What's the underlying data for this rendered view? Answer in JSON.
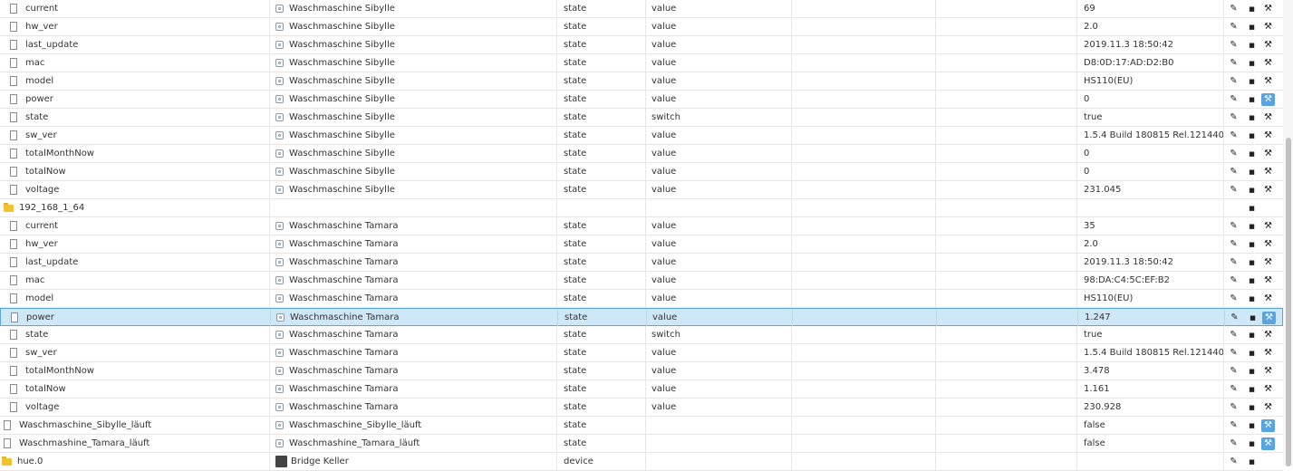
{
  "table": {
    "rows": [
      {
        "kind": "state",
        "indent": 1,
        "id": "current",
        "name": "Waschmaschine Sibylle",
        "role": "state",
        "type": "value",
        "value": "69",
        "wrench_active": false
      },
      {
        "kind": "state",
        "indent": 1,
        "id": "hw_ver",
        "name": "Waschmaschine Sibylle",
        "role": "state",
        "type": "value",
        "value": "2.0",
        "wrench_active": false
      },
      {
        "kind": "state",
        "indent": 1,
        "id": "last_update",
        "name": "Waschmaschine Sibylle",
        "role": "state",
        "type": "value",
        "value": "2019.11.3 18:50:42",
        "wrench_active": false
      },
      {
        "kind": "state",
        "indent": 1,
        "id": "mac",
        "name": "Waschmaschine Sibylle",
        "role": "state",
        "type": "value",
        "value": "D8:0D:17:AD:D2:B0",
        "wrench_active": false
      },
      {
        "kind": "state",
        "indent": 1,
        "id": "model",
        "name": "Waschmaschine Sibylle",
        "role": "state",
        "type": "value",
        "value": "HS110(EU)",
        "wrench_active": false
      },
      {
        "kind": "state",
        "indent": 1,
        "id": "power",
        "name": "Waschmaschine Sibylle",
        "role": "state",
        "type": "value",
        "value": "0",
        "wrench_active": true
      },
      {
        "kind": "state",
        "indent": 1,
        "id": "state",
        "name": "Waschmaschine Sibylle",
        "role": "state",
        "type": "switch",
        "value": "true",
        "wrench_active": false
      },
      {
        "kind": "state",
        "indent": 1,
        "id": "sw_ver",
        "name": "Waschmaschine Sibylle",
        "role": "state",
        "type": "value",
        "value": "1.5.4 Build 180815 Rel.121440",
        "wrench_active": false
      },
      {
        "kind": "state",
        "indent": 1,
        "id": "totalMonthNow",
        "name": "Waschmaschine Sibylle",
        "role": "state",
        "type": "value",
        "value": "0",
        "wrench_active": false
      },
      {
        "kind": "state",
        "indent": 1,
        "id": "totalNow",
        "name": "Waschmaschine Sibylle",
        "role": "state",
        "type": "value",
        "value": "0",
        "wrench_active": false
      },
      {
        "kind": "state",
        "indent": 1,
        "id": "voltage",
        "name": "Waschmaschine Sibylle",
        "role": "state",
        "type": "value",
        "value": "231.045",
        "wrench_active": false
      },
      {
        "kind": "folder",
        "indent": 0,
        "id": "192_168_1_64",
        "name": "",
        "role": "",
        "type": "",
        "value": "",
        "wrench_active": false
      },
      {
        "kind": "state",
        "indent": 1,
        "id": "current",
        "name": "Waschmaschine Tamara",
        "role": "state",
        "type": "value",
        "value": "35",
        "wrench_active": false
      },
      {
        "kind": "state",
        "indent": 1,
        "id": "hw_ver",
        "name": "Waschmaschine Tamara",
        "role": "state",
        "type": "value",
        "value": "2.0",
        "wrench_active": false
      },
      {
        "kind": "state",
        "indent": 1,
        "id": "last_update",
        "name": "Waschmaschine Tamara",
        "role": "state",
        "type": "value",
        "value": "2019.11.3 18:50:42",
        "wrench_active": false
      },
      {
        "kind": "state",
        "indent": 1,
        "id": "mac",
        "name": "Waschmaschine Tamara",
        "role": "state",
        "type": "value",
        "value": "98:DA:C4:5C:EF:B2",
        "wrench_active": false
      },
      {
        "kind": "state",
        "indent": 1,
        "id": "model",
        "name": "Waschmaschine Tamara",
        "role": "state",
        "type": "value",
        "value": "HS110(EU)",
        "wrench_active": false
      },
      {
        "kind": "state",
        "indent": 1,
        "id": "power",
        "name": "Waschmaschine Tamara",
        "role": "state",
        "type": "value",
        "value": "1.247",
        "wrench_active": true,
        "selected": true
      },
      {
        "kind": "state",
        "indent": 1,
        "id": "state",
        "name": "Waschmaschine Tamara",
        "role": "state",
        "type": "switch",
        "value": "true",
        "wrench_active": false
      },
      {
        "kind": "state",
        "indent": 1,
        "id": "sw_ver",
        "name": "Waschmaschine Tamara",
        "role": "state",
        "type": "value",
        "value": "1.5.4 Build 180815 Rel.121440",
        "wrench_active": false
      },
      {
        "kind": "state",
        "indent": 1,
        "id": "totalMonthNow",
        "name": "Waschmaschine Tamara",
        "role": "state",
        "type": "value",
        "value": "3.478",
        "wrench_active": false
      },
      {
        "kind": "state",
        "indent": 1,
        "id": "totalNow",
        "name": "Waschmaschine Tamara",
        "role": "state",
        "type": "value",
        "value": "1.161",
        "wrench_active": false
      },
      {
        "kind": "state",
        "indent": 1,
        "id": "voltage",
        "name": "Waschmaschine Tamara",
        "role": "state",
        "type": "value",
        "value": "230.928",
        "wrench_active": false
      },
      {
        "kind": "state",
        "indent": 0,
        "id": "Waschmaschine_Sibylle_läuft",
        "name": "Waschmaschine_Sibylle_läuft",
        "role": "state",
        "type": "",
        "value": "false",
        "wrench_active": true
      },
      {
        "kind": "state",
        "indent": 0,
        "id": "Waschmashine_Tamara_läuft",
        "name": "Waschmashine_Tamara_läuft",
        "role": "state",
        "type": "",
        "value": "false",
        "wrench_active": true
      },
      {
        "kind": "device",
        "indent": -1,
        "id": "hue.0",
        "name": "Bridge Keller",
        "role": "device",
        "type": "",
        "value": "",
        "wrench_active": false
      }
    ]
  },
  "icons": {
    "file": "file-icon",
    "folder": "folder-icon",
    "state": "state-icon",
    "device_image": "device-image-icon",
    "edit": "pencil-icon",
    "delete": "trash-icon",
    "custom": "wrench-icon"
  },
  "colors": {
    "selected_row_bg": "#cfe8f7",
    "selected_row_border": "#5aa7d9",
    "wrench_active": "#58a4e0",
    "folder": "#f2c231"
  }
}
